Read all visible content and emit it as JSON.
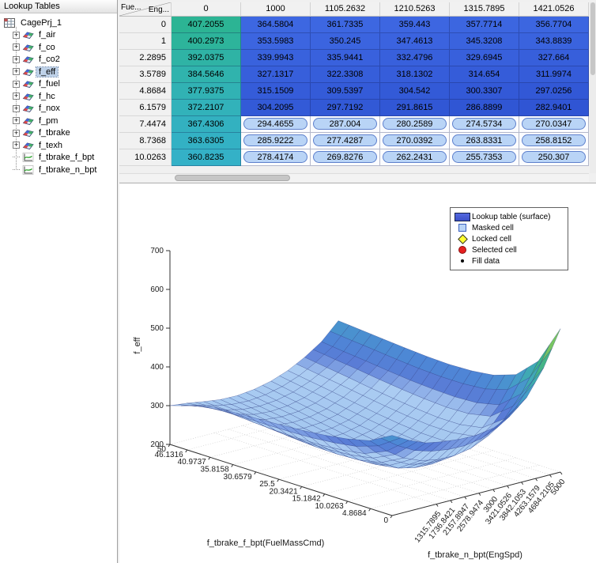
{
  "sidebar": {
    "title": "Lookup Tables",
    "root": {
      "label": "CagePrj_1"
    },
    "items": [
      {
        "label": "f_air",
        "type": "table",
        "selected": false
      },
      {
        "label": "f_co",
        "type": "table",
        "selected": false
      },
      {
        "label": "f_co2",
        "type": "table",
        "selected": false
      },
      {
        "label": "f_eff",
        "type": "table",
        "selected": true
      },
      {
        "label": "f_fuel",
        "type": "table",
        "selected": false
      },
      {
        "label": "f_hc",
        "type": "table",
        "selected": false
      },
      {
        "label": "f_nox",
        "type": "table",
        "selected": false
      },
      {
        "label": "f_pm",
        "type": "table",
        "selected": false
      },
      {
        "label": "f_tbrake",
        "type": "table",
        "selected": false
      },
      {
        "label": "f_texh",
        "type": "table",
        "selected": false
      },
      {
        "label": "f_tbrake_f_bpt",
        "type": "breakpoint",
        "selected": false
      },
      {
        "label": "f_tbrake_n_bpt",
        "type": "breakpoint",
        "selected": false
      }
    ]
  },
  "table": {
    "corner_top": "Fue...",
    "corner_bottom": "Eng...",
    "col_headers": [
      "0",
      "1000",
      "1105.2632",
      "1210.5263",
      "1315.7895",
      "1421.0526"
    ],
    "row_headers": [
      "0",
      "1",
      "2.2895",
      "3.5789",
      "4.8684",
      "6.1579",
      "7.4474",
      "8.7368",
      "10.0263"
    ],
    "values": [
      [
        "407.2055",
        "364.5804",
        "361.7335",
        "359.443",
        "357.7714",
        "356.7704"
      ],
      [
        "400.2973",
        "353.5983",
        "350.245",
        "347.4613",
        "345.3208",
        "343.8839"
      ],
      [
        "392.0375",
        "339.9943",
        "335.9441",
        "332.4796",
        "329.6945",
        "327.664"
      ],
      [
        "384.5646",
        "327.1317",
        "322.3308",
        "318.1302",
        "314.654",
        "311.9974"
      ],
      [
        "377.9375",
        "315.1509",
        "309.5397",
        "304.542",
        "300.3307",
        "297.0256"
      ],
      [
        "372.2107",
        "304.2095",
        "297.7192",
        "291.8615",
        "286.8899",
        "282.9401"
      ],
      [
        "367.4306",
        "294.4655",
        "287.004",
        "280.2589",
        "274.5734",
        "270.0347"
      ],
      [
        "363.6305",
        "285.9222",
        "277.4287",
        "270.0392",
        "263.8331",
        "258.8152"
      ],
      [
        "360.8235",
        "278.4174",
        "269.8276",
        "262.2431",
        "255.7353",
        "250.307"
      ]
    ],
    "masked_region": {
      "row_start": 6,
      "col_start": 1
    }
  },
  "chart_data": {
    "type": "surface",
    "zlabel": "f_eff",
    "xlabel": "f_tbrake_n_bpt(EngSpd)",
    "ylabel": "f_tbrake_f_bpt(FuelMassCmd)",
    "zlim": [
      200,
      700
    ],
    "x_range": [
      0,
      5000
    ],
    "y_range": [
      0,
      50
    ],
    "z_tick_labels": [
      "200",
      "300",
      "400",
      "500",
      "600",
      "700"
    ],
    "z_tick_values": [
      200,
      300,
      400,
      500,
      600,
      700
    ],
    "speed_tick_labels": [
      "1315.7895",
      "1736.8421",
      "2157.8947",
      "2578.9474",
      "3000",
      "3421.0526",
      "3842.1053",
      "4263.1579",
      "4684.2105",
      "5000"
    ],
    "speed_tick_values": [
      1315.7895,
      1736.8421,
      2157.8947,
      2578.9474,
      3000,
      3421.0526,
      3842.1053,
      4263.1579,
      4684.2105,
      5000
    ],
    "fuel_tick_labels": [
      "50",
      "46.1316",
      "40.9737",
      "35.8158",
      "30.6579",
      "25.5",
      "20.3421",
      "15.1842",
      "10.0263",
      "4.8684",
      "0"
    ],
    "fuel_tick_values": [
      50,
      46.1316,
      40.9737,
      35.8158,
      30.6579,
      25.5,
      20.3421,
      15.1842,
      10.0263,
      4.8684,
      0
    ],
    "x_speed_grid": [
      0,
      500,
      1000,
      1500,
      2000,
      2500,
      3000,
      3500,
      4000,
      4500,
      5000
    ],
    "y_fuel_grid": [
      0,
      5,
      10,
      15,
      20,
      25,
      30,
      35,
      40,
      45,
      50
    ],
    "z_grid_estimated": [
      [
        407,
        383,
        365,
        357,
        352,
        351,
        358,
        378,
        415,
        480,
        570
      ],
      [
        375,
        337,
        308,
        290,
        281,
        280,
        288,
        308,
        342,
        395,
        468
      ],
      [
        361,
        312,
        278,
        252,
        242,
        240,
        248,
        268,
        300,
        348,
        415
      ],
      [
        352,
        303,
        266,
        243,
        233,
        232,
        240,
        260,
        290,
        335,
        395
      ],
      [
        346,
        298,
        263,
        241,
        232,
        232,
        241,
        261,
        290,
        332,
        388
      ],
      [
        342,
        297,
        264,
        244,
        236,
        237,
        247,
        267,
        295,
        334,
        386
      ],
      [
        339,
        298,
        268,
        250,
        243,
        245,
        255,
        275,
        302,
        338,
        388
      ],
      [
        336,
        301,
        274,
        258,
        252,
        255,
        265,
        284,
        310,
        344,
        392
      ],
      [
        333,
        305,
        281,
        267,
        263,
        266,
        276,
        294,
        319,
        351,
        397
      ],
      [
        318,
        303,
        285,
        275,
        272,
        276,
        286,
        303,
        327,
        357,
        402
      ],
      [
        300,
        295,
        288,
        282,
        281,
        286,
        296,
        312,
        335,
        364,
        407
      ]
    ],
    "legend": [
      {
        "label": "Lookup table (surface)",
        "marker": "surface"
      },
      {
        "label": "Masked cell",
        "marker": "masked-square"
      },
      {
        "label": "Locked cell",
        "marker": "locked-diamond"
      },
      {
        "label": "Selected cell",
        "marker": "selected-circle"
      },
      {
        "label": "Fill data",
        "marker": "fill-dot"
      }
    ],
    "colors": {
      "masked_cell": "#b9d4f6",
      "locked_cell": "#ffff00",
      "selected_cell": "#ff0000",
      "fill_data": "#000000",
      "surface_low": "#aac8ee",
      "surface_mid": "#4f86d6",
      "surface_high": "#3eb48e"
    }
  }
}
